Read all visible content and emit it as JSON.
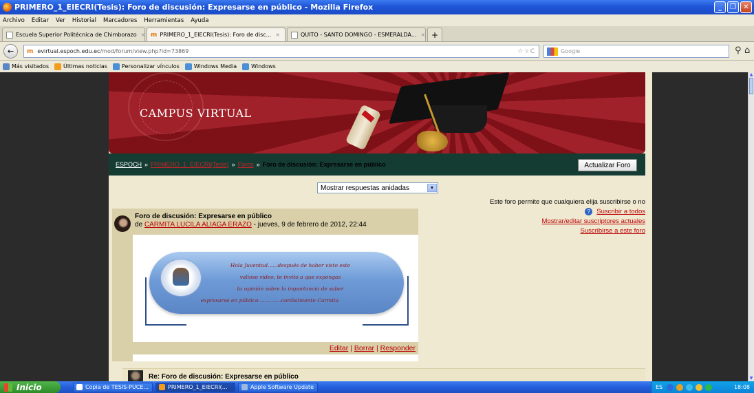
{
  "window": {
    "title": "PRIMERO_1_EIECRI(Tesis): Foro de discusión: Expresarse en público - Mozilla Firefox"
  },
  "menu": [
    "Archivo",
    "Editar",
    "Ver",
    "Historial",
    "Marcadores",
    "Herramientas",
    "Ayuda"
  ],
  "tabs": [
    {
      "label": "Escuela Superior Politécnica de Chimborazo"
    },
    {
      "label": "PRIMERO_1_EIECRI(Tesis): Foro de disc..."
    },
    {
      "label": "QUITO - SANTO DOMINGO - ESMERALDA..."
    }
  ],
  "nav": {
    "url_host": "evirtual.espoch.edu.ec",
    "url_path": "/mod/forum/view.php?id=73869",
    "search_placeholder": "Google"
  },
  "bookmarks": [
    "Más visitados",
    "Últimas noticias",
    "Personalizar vínculos",
    "Windows Media",
    "Windows"
  ],
  "banner": {
    "title": "CAMPUS VIRTUAL"
  },
  "breadcrumb": {
    "home": "ESPOCH",
    "course": "PRIMERO_1_EIECRI(Tesis)",
    "forums": "Foros",
    "current": "Foro de discusión: Expresarse en público",
    "sep": "»"
  },
  "update_button": "Actualizar Foro",
  "display_mode": "Mostrar respuestas anidadas",
  "subscription": {
    "info": "Este foro permite que cualquiera elija suscribirse o no",
    "subscribe_all": "Suscribir a todos",
    "show_edit": "Mostrar/editar suscriptores actuales",
    "subscribe_this": "Suscribirse a este foro"
  },
  "post": {
    "subject": "Foro de discusión: Expresarse en público",
    "by_prefix": "de",
    "author": "CARMITA LUCILA ALIAGA ERAZO",
    "date": "- jueves, 9 de febrero de 2012, 22:44",
    "message_lines": [
      "Hola Juventud......después de haber visto este",
      "valioso video, te invito a que expongas",
      "tu opinión sobre la importancia de saber",
      "expresarse en público..............cordialmente Carmita"
    ],
    "actions": {
      "edit": "Editar",
      "delete": "Borrar",
      "reply": "Responder",
      "sep": "|"
    }
  },
  "reply": {
    "subject": "Re: Foro de discusión: Expresarse en público"
  },
  "taskbar": {
    "start": "Inicio",
    "tasks": [
      "Copia de TESIS-PUCE...",
      "PRIMERO_1_EIECRI(...",
      "Apple Software Update"
    ],
    "lang": "ES",
    "clock": "18:08"
  },
  "colors": {
    "link_red": "#b00000",
    "crumb_bg": "#153c33",
    "post_header": "#d9cfa9",
    "page_bg": "#efe9d2"
  }
}
